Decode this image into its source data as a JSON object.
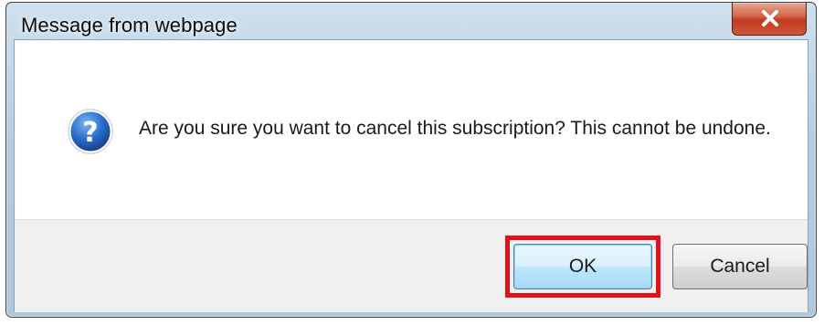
{
  "dialog": {
    "title": "Message from webpage",
    "message": "Are you sure you want to cancel this subscription? This cannot be undone.",
    "icon": "question-icon",
    "buttons": {
      "ok_label": "OK",
      "cancel_label": "Cancel"
    }
  },
  "colors": {
    "highlight": "#e3101e",
    "close_button": "#c03b1f",
    "icon_blue": "#1f5fb8"
  }
}
